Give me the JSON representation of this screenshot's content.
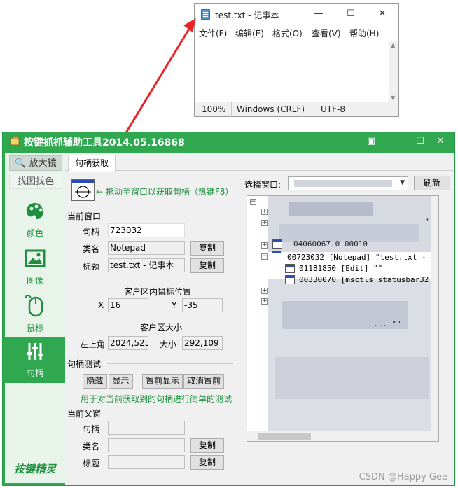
{
  "notepad": {
    "title": "test.txt - 记事本",
    "menu": [
      "文件(F)",
      "编辑(E)",
      "格式(O)",
      "查看(V)",
      "帮助(H)"
    ],
    "status": {
      "zoom": "100%",
      "line_ending": "Windows (CRLF)",
      "encoding": "UTF-8"
    }
  },
  "tool": {
    "title": "按键抓抓辅助工具2014.05.16868",
    "sidebar": {
      "magnifier": "放大镜",
      "find_by_image": "找图找色",
      "items": [
        "颜色",
        "图像",
        "鼠标",
        "句柄"
      ],
      "logo": "按键精灵"
    },
    "tab": "句柄获取",
    "drag_hint": "← 拖动至窗口以获取句柄（热键F8）",
    "current_window": {
      "heading": "当前窗口",
      "handle_label": "句柄",
      "handle_value": "723032",
      "class_label": "类名",
      "class_value": "Notepad",
      "title_label": "标题",
      "title_value": "test.txt - 记事本",
      "copy": "复制"
    },
    "mouse_pos": {
      "heading": "客户区内鼠标位置",
      "x_label": "X",
      "x_value": "16",
      "y_label": "Y",
      "y_value": "-35"
    },
    "client_size": {
      "heading": "客户区大小",
      "topleft_label": "左上角",
      "topleft_value": "2024,525",
      "size_label": "大小",
      "size_value": "292,109"
    },
    "handle_test": {
      "heading": "句柄测试",
      "buttons": [
        "隐藏",
        "显示",
        "置前显示",
        "取消置前"
      ],
      "note": "用于对当前获取到的句柄进行简单的测试"
    },
    "parent_window": {
      "heading": "当前父窗",
      "handle_label": "句柄",
      "class_label": "类名",
      "title_label": "标题",
      "copy": "复制"
    },
    "select_window_label": "选择窗口:",
    "refresh": "刷新",
    "tree": [
      "00723032 [Notepad] \"test.txt -",
      "01181850 [Edit] \"\"",
      "00330070 [msctls_statusbar32"
    ],
    "tree_fragments": [
      "\"",
      "04060067.0.00010",
      "... \"\""
    ]
  },
  "watermark": "CSDN @Happy Gee"
}
